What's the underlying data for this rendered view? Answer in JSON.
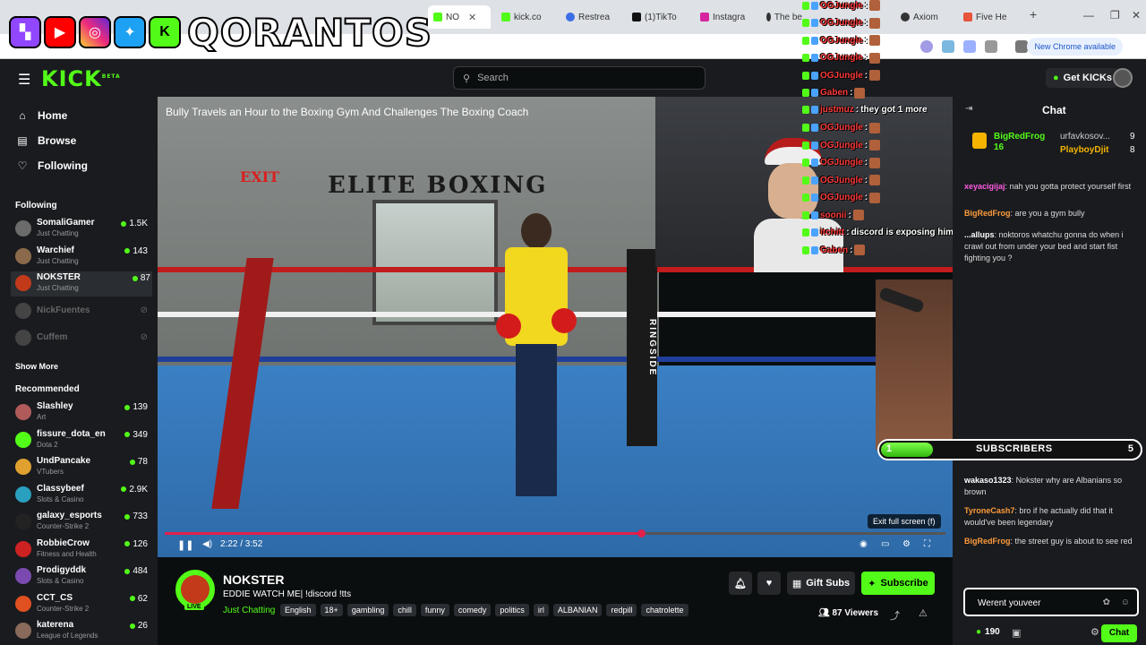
{
  "browser": {
    "tabs": [
      {
        "label": "NO",
        "color": "#53fc18"
      },
      {
        "label": "kick.co",
        "color": "#53fc18"
      },
      {
        "label": "Restrea",
        "color": "#3b6ee6"
      },
      {
        "label": "(1)TikTo",
        "color": "#111111"
      },
      {
        "label": "Instagra",
        "color": "#d6249f"
      },
      {
        "label": "The be",
        "color": "#333333"
      },
      {
        "label": "Axiom",
        "color": "#333333"
      },
      {
        "label": "Five He",
        "color": "#e8543d"
      }
    ],
    "update_label": "New Chrome available"
  },
  "overlay": {
    "brand": "QORANTOS",
    "socials": [
      "twitch-icon",
      "youtube-icon",
      "instagram-icon",
      "twitter-icon",
      "kick-icon"
    ]
  },
  "header": {
    "logo": "KICK",
    "logo_sup": "BETA",
    "search_placeholder": "Search",
    "get_kicks": "Get KICKs"
  },
  "sidebar": {
    "nav": [
      {
        "label": "Home",
        "icon": "home-icon"
      },
      {
        "label": "Browse",
        "icon": "browse-icon"
      },
      {
        "label": "Following",
        "icon": "heart-icon"
      }
    ],
    "following_title": "Following",
    "following": [
      {
        "name": "SomaliGamer",
        "category": "Just Chatting",
        "viewers": "1.5K",
        "color": "#6b6b6b"
      },
      {
        "name": "Warchief",
        "category": "Just Chatting",
        "viewers": "143",
        "color": "#8a6a4a"
      },
      {
        "name": "NOKSTER",
        "category": "Just Chatting",
        "viewers": "87",
        "color": "#c23a1a"
      },
      {
        "name": "NickFuentes",
        "category": "",
        "viewers": "",
        "color": "#444444"
      },
      {
        "name": "Cuffem",
        "category": "",
        "viewers": "",
        "color": "#444444"
      }
    ],
    "show_more": "Show More",
    "recommended_title": "Recommended",
    "recommended": [
      {
        "name": "Slashley",
        "category": "Art",
        "viewers": "139",
        "color": "#b05a5a"
      },
      {
        "name": "fissure_dota_en",
        "category": "Dota 2",
        "viewers": "349",
        "color": "#53fc18"
      },
      {
        "name": "UndPancake",
        "category": "VTubers",
        "viewers": "78",
        "color": "#e0a030"
      },
      {
        "name": "Classybeef",
        "category": "Slots & Casino",
        "viewers": "2.9K",
        "color": "#2aa0c0"
      },
      {
        "name": "galaxy_esports",
        "category": "Counter-Strike 2",
        "viewers": "733",
        "color": "#222222"
      },
      {
        "name": "RobbieCrow",
        "category": "Fitness and Health",
        "viewers": "126",
        "color": "#cc2222"
      },
      {
        "name": "Prodigyddk",
        "category": "Slots & Casino",
        "viewers": "484",
        "color": "#7a4ab0"
      },
      {
        "name": "CCT_CS",
        "category": "Counter-Strike 2",
        "viewers": "62",
        "color": "#e05020"
      },
      {
        "name": "katerena",
        "category": "League of Legends",
        "viewers": "26",
        "color": "#8a6a5a"
      }
    ]
  },
  "video": {
    "title": "Bully Travels an Hour to the Boxing Gym And Challenges The Boxing Coach",
    "banner": "ELITE BOXING",
    "exit_sign": "EXIT",
    "ringside": "RINGSIDE",
    "time": "2:22 / 3:52",
    "progress": 0.61,
    "exit_fullscreen": "Exit full screen (f)"
  },
  "overlay_chat": [
    {
      "user": "OGJungle",
      "text": ""
    },
    {
      "user": "OGJungle",
      "text": ""
    },
    {
      "user": "OGJungle",
      "text": ""
    },
    {
      "user": "OGJungle",
      "text": ""
    },
    {
      "user": "OGJungle",
      "text": ""
    },
    {
      "user": "Gaben",
      "text": ""
    },
    {
      "user": "justmuz",
      "text": "they got 1 more"
    },
    {
      "user": "OGJungle",
      "text": ""
    },
    {
      "user": "OGJungle",
      "text": ""
    },
    {
      "user": "OGJungle",
      "text": ""
    },
    {
      "user": "OGJungle",
      "text": ""
    },
    {
      "user": "OGJungle",
      "text": ""
    },
    {
      "user": "soonii",
      "text": ""
    },
    {
      "user": "itchitt",
      "text": "discord is exposing him it looks like"
    },
    {
      "user": "Gaben",
      "text": ""
    }
  ],
  "subscribers": {
    "label": "SUBSCRIBERS",
    "current": "1",
    "goal": "5",
    "fraction": 0.2
  },
  "chat": {
    "title": "Chat",
    "pinned_user": "BigRedFrog",
    "pinned_count": "16",
    "pinned_user2": "urfavkosov...",
    "pinned_count2": "9",
    "pinned_user3": "PlayboyDjit",
    "pinned_count3": "8",
    "messages_top": [
      {
        "user": "xeyacigijaj",
        "color": "#ff5be0",
        "text": "nah you gotta protect yourself first"
      },
      {
        "user": "BigRedFrog",
        "color": "#ff9c3b",
        "text": "are you a gym bully"
      },
      {
        "user": "...allups",
        "color": "#ffffff",
        "text": "noktoros whatchu gonna do when i crawl out from under your bed and start fist fighting you ?"
      }
    ],
    "messages_bottom": [
      {
        "user": "wakaso1323",
        "color": "#ffffff",
        "text": "Nokster why are Albanians so brown"
      },
      {
        "user": "TyroneCash7",
        "color": "#ff9c3b",
        "text": "bro if he actually did that it would've been legendary"
      },
      {
        "user": "BigRedFrog",
        "color": "#ff9c3b",
        "text": "the street guy is about to see red"
      }
    ],
    "input_value": "Werent youveer",
    "kicks": "190",
    "send": "Chat"
  },
  "channel": {
    "name": "NOKSTER",
    "live": "LIVE",
    "title": "EDDIE WATCH ME| !discord !tts",
    "category": "Just Chatting",
    "tags": [
      "English",
      "18+",
      "gambling",
      "chill",
      "funny",
      "comedy",
      "politics",
      "irl",
      "ALBANIAN",
      "redpill",
      "chatrolette"
    ],
    "gift": "Gift Subs",
    "subscribe": "Subscribe",
    "viewers": "87",
    "viewers_label": "Viewers"
  }
}
